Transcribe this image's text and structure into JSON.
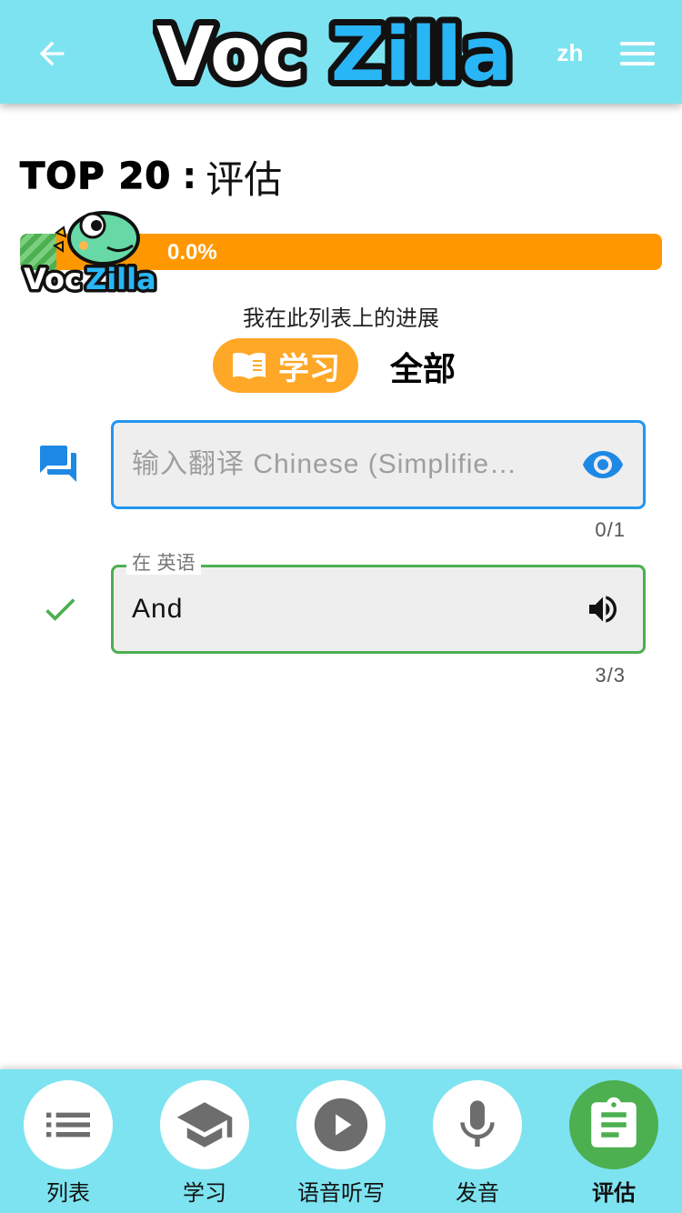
{
  "header": {
    "logo_text_left": "Voc",
    "logo_text_right": "Zilla",
    "language": "zh"
  },
  "page": {
    "title_main": "TOP 20",
    "title_sep": ":",
    "title_sub": "评估"
  },
  "progress": {
    "mascot_text_left": "Voc",
    "mascot_text_right": "Zilla",
    "percent_label": "0.0%",
    "value": 0.0,
    "caption": "我在此列表上的进展"
  },
  "toggle": {
    "learn_label": "学习",
    "all_label": "全部"
  },
  "translate_field": {
    "placeholder": "输入翻译 Chinese (Simplifie…",
    "counter": "0/1"
  },
  "answer_field": {
    "label": "在 英语",
    "value": "And",
    "counter": "3/3"
  },
  "nav": {
    "items": [
      {
        "label": "列表",
        "icon": "list-icon"
      },
      {
        "label": "学习",
        "icon": "graduation-cap-icon"
      },
      {
        "label": "语音听写",
        "icon": "play-icon"
      },
      {
        "label": "发音",
        "icon": "microphone-icon"
      },
      {
        "label": "评估",
        "icon": "clipboard-icon"
      }
    ],
    "active_index": 4
  },
  "colors": {
    "header_bg": "#7ee3f0",
    "progress_orange": "#ff9800",
    "toggle_orange": "#ffa726",
    "blue": "#2196f3",
    "green": "#4caf50",
    "nav_icon_gray": "#6d6d6d"
  }
}
